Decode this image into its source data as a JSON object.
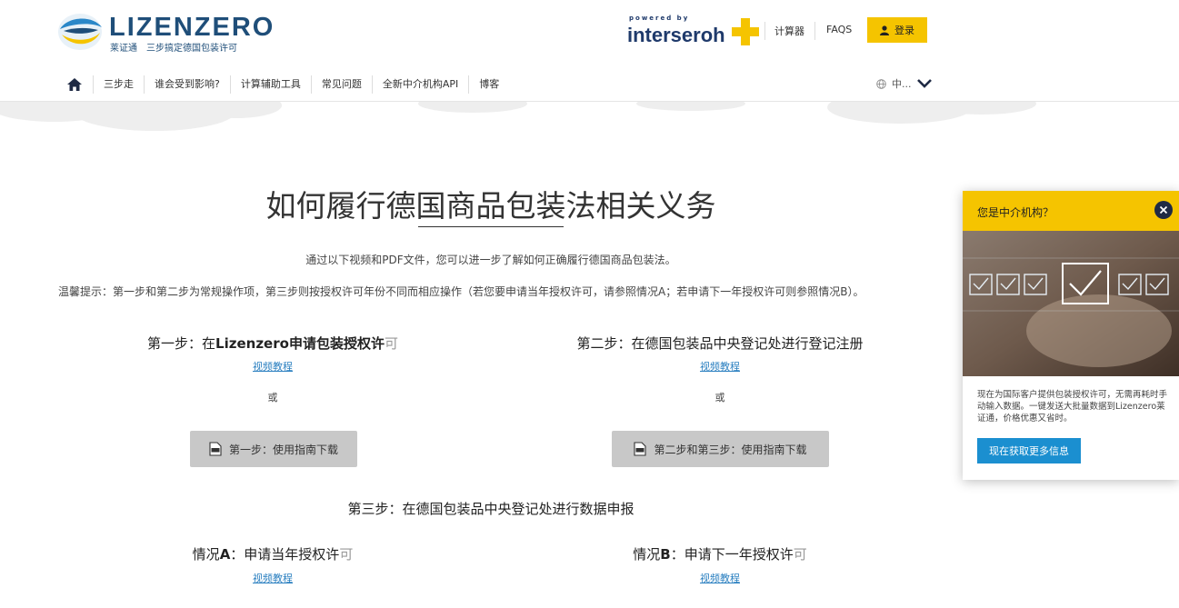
{
  "header": {
    "logo": {
      "name": "LIZENZERO",
      "tagline": "莱证通　三步搞定德国包装许可"
    },
    "partner": {
      "powered_by": "powered by",
      "name": "interseroh"
    },
    "top_links": {
      "calculator": "计算器",
      "faqs": "FAQS"
    },
    "login_label": "登录",
    "nav": [
      {
        "label": "三步走"
      },
      {
        "label": "谁会受到影响?"
      },
      {
        "label": "计算辅助工具"
      },
      {
        "label": "常见问题"
      },
      {
        "label": "全新中介机构API"
      },
      {
        "label": "博客"
      }
    ],
    "language": "中..."
  },
  "main": {
    "title": "如何履行德国商品包装法相关义务",
    "intro": "通过以下视频和PDF文件，您可以进一步了解如何正确履行德国商品包装法。",
    "tip": "温馨提示：第一步和第二步为常规操作项，第三步则按授权许可年份不同而相应操作（若您要申请当年授权许可，请参照情况A；若申请下一年授权许可则参照情况B）。",
    "step1": {
      "prefix": "第一步：在",
      "brand": "Lizenzero",
      "main": "申请包装授权许",
      "tail": "可",
      "video_link": "视频教程",
      "or": "或",
      "download": "第一步：使用指南下载"
    },
    "step2": {
      "title": "第二步：在德国包装品中央登记处进行登记注册",
      "video_link": "视频教程",
      "or": "或",
      "download": "第二步和第三步：使用指南下载"
    },
    "step3": {
      "title": "第三步：在德国包装品中央登记处进行数据申报"
    },
    "case_a": {
      "prefix": "情况",
      "letter": "A",
      "main": "：申请当年授权许",
      "tail": "可",
      "video_link": "视频教程"
    },
    "case_b": {
      "prefix": "情况",
      "letter": "B",
      "main": "：申请下一年授权许",
      "tail": "可",
      "video_link": "视频教程"
    }
  },
  "popup": {
    "title": "您是中介机构？",
    "text": "现在为国际客户提供包装授权许可，无需再耗时手动输入数据。一键发送大批量数据到Lizenzero莱证通，价格优惠又省时。",
    "button": "现在获取更多信息"
  },
  "colors": {
    "accent_yellow": "#f5c400",
    "brand_blue": "#1f4e79",
    "link_blue": "#2a7fc0",
    "cta_blue": "#1b8fd0"
  }
}
